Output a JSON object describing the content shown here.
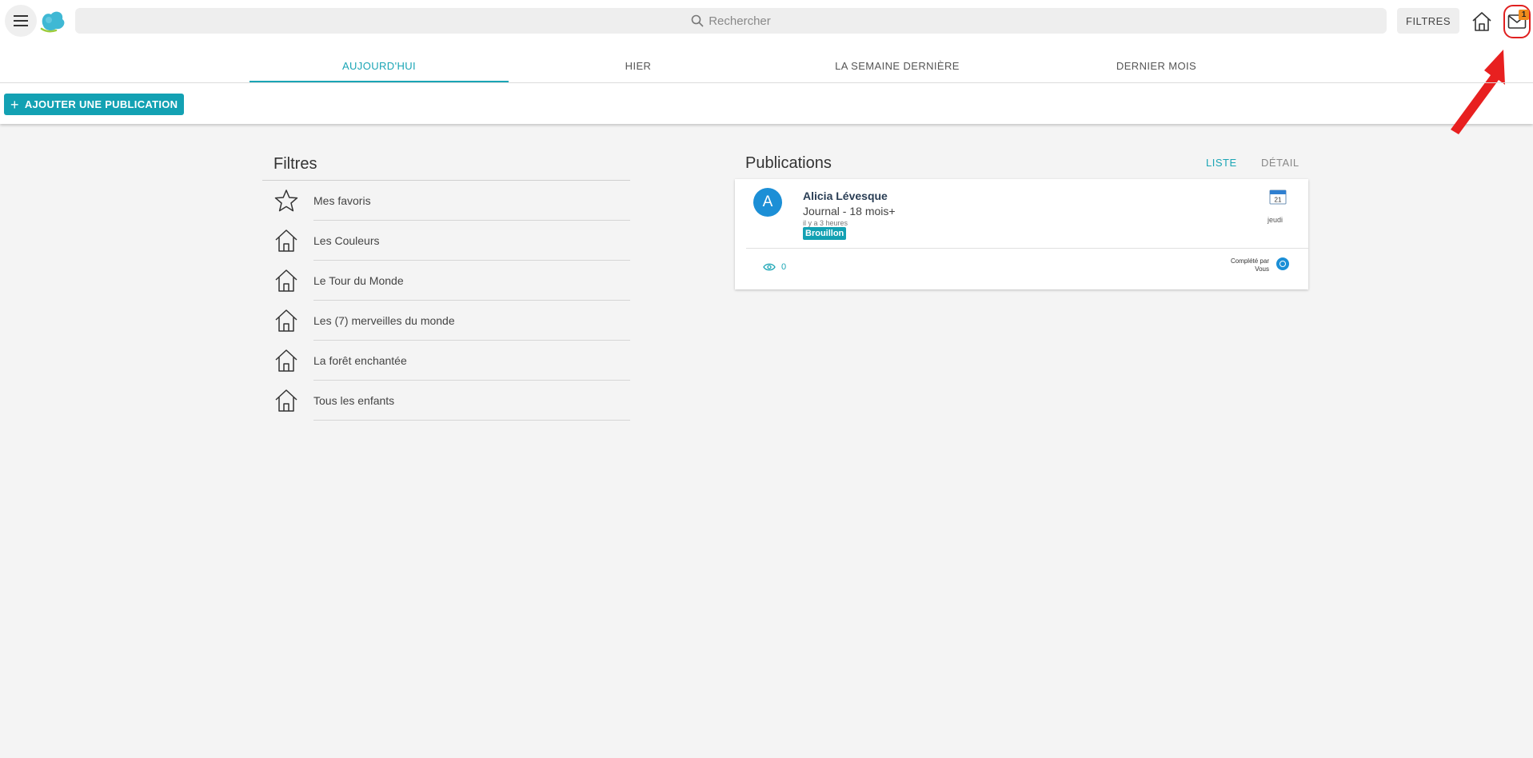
{
  "header": {
    "search_placeholder": "Rechercher",
    "filters_label": "FILTRES",
    "mail_badge": "1",
    "icons": [
      "menu-icon",
      "logo-icon",
      "search-icon",
      "home-icon",
      "mail-icon"
    ]
  },
  "tabs": [
    {
      "label": "AUJOURD'HUI",
      "active": true
    },
    {
      "label": "HIER",
      "active": false
    },
    {
      "label": "LA SEMAINE DERNIÈRE",
      "active": false
    },
    {
      "label": "DERNIER MOIS",
      "active": false
    }
  ],
  "add_publication_label": "AJOUTER UNE PUBLICATION",
  "filtres": {
    "title": "Filtres",
    "items": [
      {
        "label": "Mes favoris",
        "icon": "star-icon"
      },
      {
        "label": "Les Couleurs",
        "icon": "home-icon"
      },
      {
        "label": "Le Tour du Monde",
        "icon": "home-icon"
      },
      {
        "label": "Les (7) merveilles du monde",
        "icon": "home-icon"
      },
      {
        "label": "La forêt enchantée",
        "icon": "home-icon"
      },
      {
        "label": "Tous les enfants",
        "icon": "home-icon"
      }
    ]
  },
  "publications": {
    "title": "Publications",
    "view_list": "LISTE",
    "view_detail": "DÉTAIL",
    "card": {
      "avatar_letter": "A",
      "author": "Alicia Lévesque",
      "journal": "Journal - 18 mois+",
      "time_ago": "il y a 3 heures",
      "status": "Brouillon",
      "calendar_day": "21",
      "weekday": "jeudi",
      "views": "0",
      "completed_by_label": "Complété par",
      "completed_by": "Vous"
    }
  },
  "colors": {
    "accent": "#13a1b3",
    "avatar": "#1c8fd6",
    "badge": "#f08c1c",
    "highlight": "#e02020"
  }
}
